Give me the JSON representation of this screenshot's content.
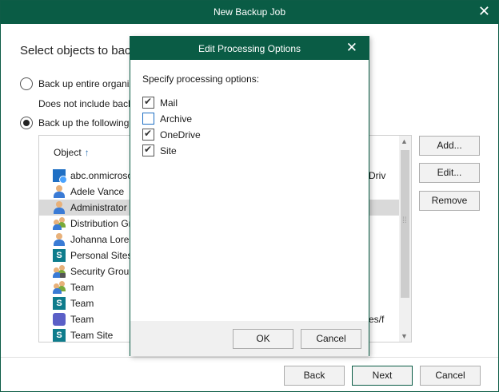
{
  "window": {
    "title": "New Backup Job",
    "close_glyph": "✕"
  },
  "page": {
    "heading": "Select objects to bac",
    "option_entire": "Back up entire organiz",
    "option_entire_note": "Does not include back",
    "option_following": "Back up the following"
  },
  "table": {
    "column_object": "Object",
    "sort_arrow": "↑",
    "rows": [
      {
        "icon": "organization-icon",
        "name": "abc.onmicrosc",
        "right": "Driv"
      },
      {
        "icon": "user-icon",
        "name": "Adele Vance",
        "right": ""
      },
      {
        "icon": "user-icon",
        "name": "Administrator",
        "right": ""
      },
      {
        "icon": "group-icon",
        "name": "Distribution Gr",
        "right": ""
      },
      {
        "icon": "user-icon",
        "name": "Johanna Loren",
        "right": ""
      },
      {
        "icon": "sharepoint-icon",
        "name": "Personal Sites",
        "right": ""
      },
      {
        "icon": "security-group-icon",
        "name": "Security Group",
        "right": ""
      },
      {
        "icon": "group-icon",
        "name": "Team",
        "right": ""
      },
      {
        "icon": "sharepoint-icon",
        "name": "Team",
        "right": ""
      },
      {
        "icon": "teams-icon",
        "name": "Team",
        "right": "es/f"
      },
      {
        "icon": "sharepoint-icon",
        "name": "Team Site",
        "right": ""
      }
    ]
  },
  "side_buttons": {
    "add": "Add...",
    "edit": "Edit...",
    "remove": "Remove"
  },
  "footer": {
    "back": "Back",
    "next": "Next",
    "cancel": "Cancel"
  },
  "dialog": {
    "title": "Edit Processing Options",
    "close_glyph": "✕",
    "prompt": "Specify processing options:",
    "options": [
      {
        "label": "Mail",
        "checked": true
      },
      {
        "label": "Archive",
        "checked": false
      },
      {
        "label": "OneDrive",
        "checked": true
      },
      {
        "label": "Site",
        "checked": true
      }
    ],
    "ok": "OK",
    "cancel": "Cancel"
  }
}
